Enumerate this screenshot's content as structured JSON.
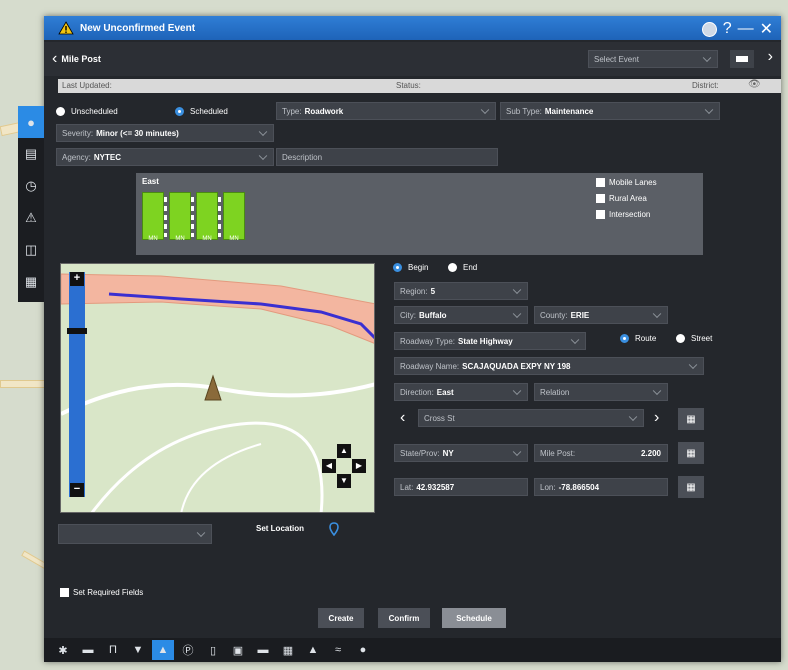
{
  "window": {
    "title": "New Unconfirmed Event"
  },
  "window_controls": {
    "help": "?",
    "minimize": "—",
    "close": "✕"
  },
  "header": {
    "back_label": "Mile Post",
    "select_event_placeholder": "Select Event"
  },
  "status_bar": {
    "last_updated_label": "Last Updated:",
    "status_label": "Status:",
    "district_label": "District:"
  },
  "sidebar": {
    "icons": [
      "location-pin-icon",
      "document-icon",
      "clock-icon",
      "alert-icon",
      "map-icon",
      "calendar-icon"
    ]
  },
  "schedule": {
    "unscheduled_label": "Unscheduled",
    "scheduled_label": "Scheduled",
    "selected": "Scheduled"
  },
  "fields": {
    "type_label": "Type:",
    "type_value": "Roadwork",
    "subtype_label": "Sub Type:",
    "subtype_value": "Maintenance",
    "severity_label": "Severity:",
    "severity_value": "Minor (<= 30 minutes)",
    "agency_label": "Agency:",
    "agency_value": "NYTEC",
    "description_placeholder": "Description"
  },
  "lanes": {
    "direction": "East",
    "lane_labels": [
      "MN",
      "MN",
      "MN",
      "MN"
    ],
    "options": [
      "Mobile Lanes",
      "Rural Area",
      "Intersection"
    ]
  },
  "location": {
    "begin_label": "Begin",
    "end_label": "End",
    "selected": "Begin",
    "region_label": "Region:",
    "region_value": "5",
    "city_label": "City:",
    "city_value": "Buffalo",
    "county_label": "County:",
    "county_value": "ERIE",
    "roadway_type_label": "Roadway Type:",
    "roadway_type_value": "State Highway",
    "route_label": "Route",
    "street_label": "Street",
    "roadway_name_label": "Roadway Name:",
    "roadway_name_value": "SCAJAQUADA EXPY NY 198",
    "direction_label": "Direction:",
    "direction_value": "East",
    "relation_label": "Relation",
    "cross_placeholder": "Cross St",
    "state_label": "State/Prov:",
    "state_value": "NY",
    "mile_post_label": "Mile Post:",
    "mile_post_value": "2.200",
    "lat_label": "Lat:",
    "lat_value": "42.932587",
    "lon_label": "Lon:",
    "lon_value": "-78.866504",
    "set_location_label": "Set Location"
  },
  "footer": {
    "set_required_label": "Set Required Fields",
    "create_label": "Create",
    "confirm_label": "Confirm",
    "schedule_label": "Schedule"
  },
  "bottom_toolbar": {
    "icons": [
      "incident-icon",
      "closure-icon",
      "construction-icon",
      "sign-icon",
      "camera-icon",
      "parking-icon",
      "bus-icon",
      "car-icon",
      "truck-icon",
      "weather-icon",
      "speed-icon",
      "wind-icon",
      "dot-icon"
    ]
  }
}
